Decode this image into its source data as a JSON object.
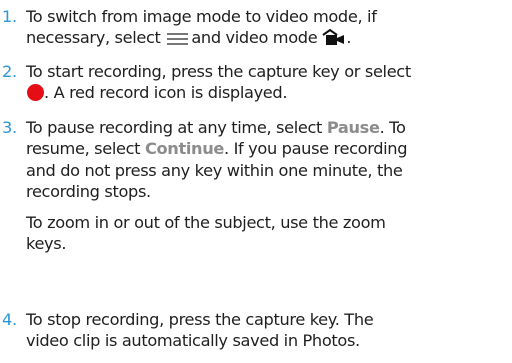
{
  "colors": {
    "step_number": "#2a97d6",
    "ui_word": "#8c8c8c",
    "record_icon": "#e40e14"
  },
  "steps": [
    {
      "number": "1.",
      "line1_a": "To switch from image mode to video mode, if",
      "line2_a": "necessary, select",
      "line2_b": "and video mode",
      "line2_c": ".",
      "icons": [
        "menu-icon",
        "video-mode-icon"
      ]
    },
    {
      "number": "2.",
      "line1": "To start recording, press the capture key or select",
      "line2_a": ". A red record icon is displayed.",
      "icons": [
        "record-icon"
      ]
    },
    {
      "number": "3.",
      "line1_a": "To pause recording at any time, select",
      "line1_ui": "Pause",
      "line1_b": ". To",
      "line2_a": "resume, select",
      "line2_ui": "Continue",
      "line2_b": ". If you pause recording",
      "line3": "and do not press any key within one minute, the",
      "line4": "recording stops.",
      "note_line1": "To zoom in or out of the subject, use the zoom",
      "note_line2": "keys."
    },
    {
      "number": "4.",
      "line1": "To stop recording, press the capture key. The",
      "line2": "video clip is automatically saved in Photos."
    }
  ]
}
